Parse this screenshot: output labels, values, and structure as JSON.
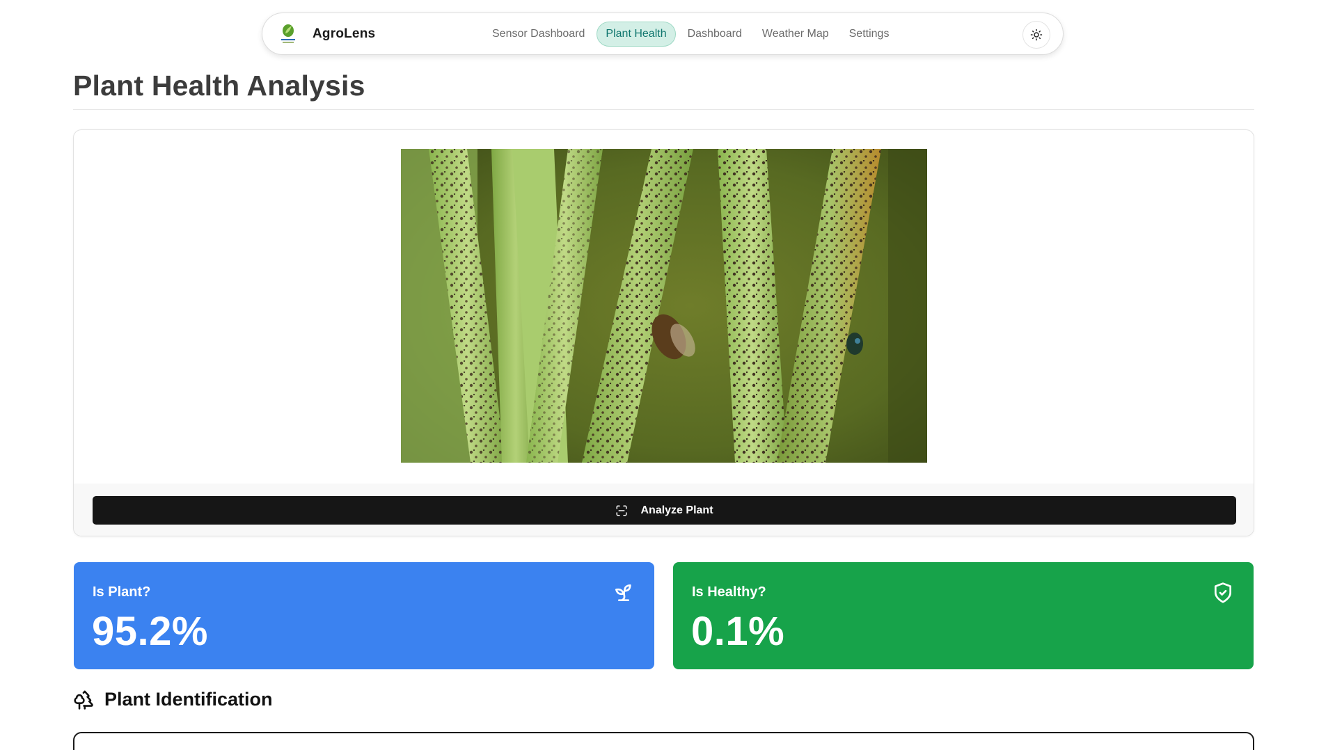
{
  "nav": {
    "brand": "AgroLens",
    "links": [
      {
        "label": "Sensor Dashboard"
      },
      {
        "label": "Plant Health"
      },
      {
        "label": "Dashboard"
      },
      {
        "label": "Weather Map"
      },
      {
        "label": "Settings"
      }
    ],
    "active_link": "Plant Health",
    "theme_icon": "sun-icon"
  },
  "page": {
    "title": "Plant Health Analysis"
  },
  "analyzer": {
    "button_label": "Analyze Plant",
    "button_icon": "scan-icon",
    "image_icon": "uploaded-plant-image"
  },
  "stats": {
    "is_plant": {
      "label": "Is Plant?",
      "value": "95.2%",
      "icon": "sprout-icon",
      "color": "#3b82f0"
    },
    "is_healthy": {
      "label": "Is Healthy?",
      "value": "0.1%",
      "icon": "shield-check-icon",
      "color": "#17a34a"
    }
  },
  "identification": {
    "title": "Plant Identification",
    "icon": "trees-icon"
  }
}
